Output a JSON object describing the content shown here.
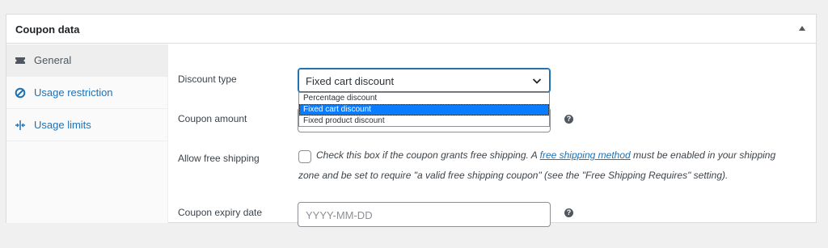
{
  "panel": {
    "title": "Coupon data"
  },
  "sidebar": {
    "items": [
      {
        "label": "General",
        "icon": "ticket-icon",
        "active": true
      },
      {
        "label": "Usage restriction",
        "icon": "ban-icon",
        "active": false
      },
      {
        "label": "Usage limits",
        "icon": "limits-icon",
        "active": false
      }
    ]
  },
  "fields": {
    "discount_type": {
      "label": "Discount type",
      "value": "Fixed cart discount",
      "options": [
        "Percentage discount",
        "Fixed cart discount",
        "Fixed product discount"
      ]
    },
    "coupon_amount": {
      "label": "Coupon amount",
      "help": "?"
    },
    "free_shipping": {
      "label": "Allow free shipping",
      "checked": false,
      "desc_before": "Check this box if the coupon grants free shipping. A ",
      "desc_link": "free shipping method",
      "desc_after": " must be enabled in your shipping",
      "desc_line2": "zone and be set to require \"a valid free shipping coupon\" (see the \"Free Shipping Requires\" setting)."
    },
    "expiry": {
      "label": "Coupon expiry date",
      "placeholder": "YYYY-MM-DD",
      "help": "?"
    }
  },
  "colors": {
    "accent": "#2271b1",
    "selected_option": "#0a7cff"
  }
}
